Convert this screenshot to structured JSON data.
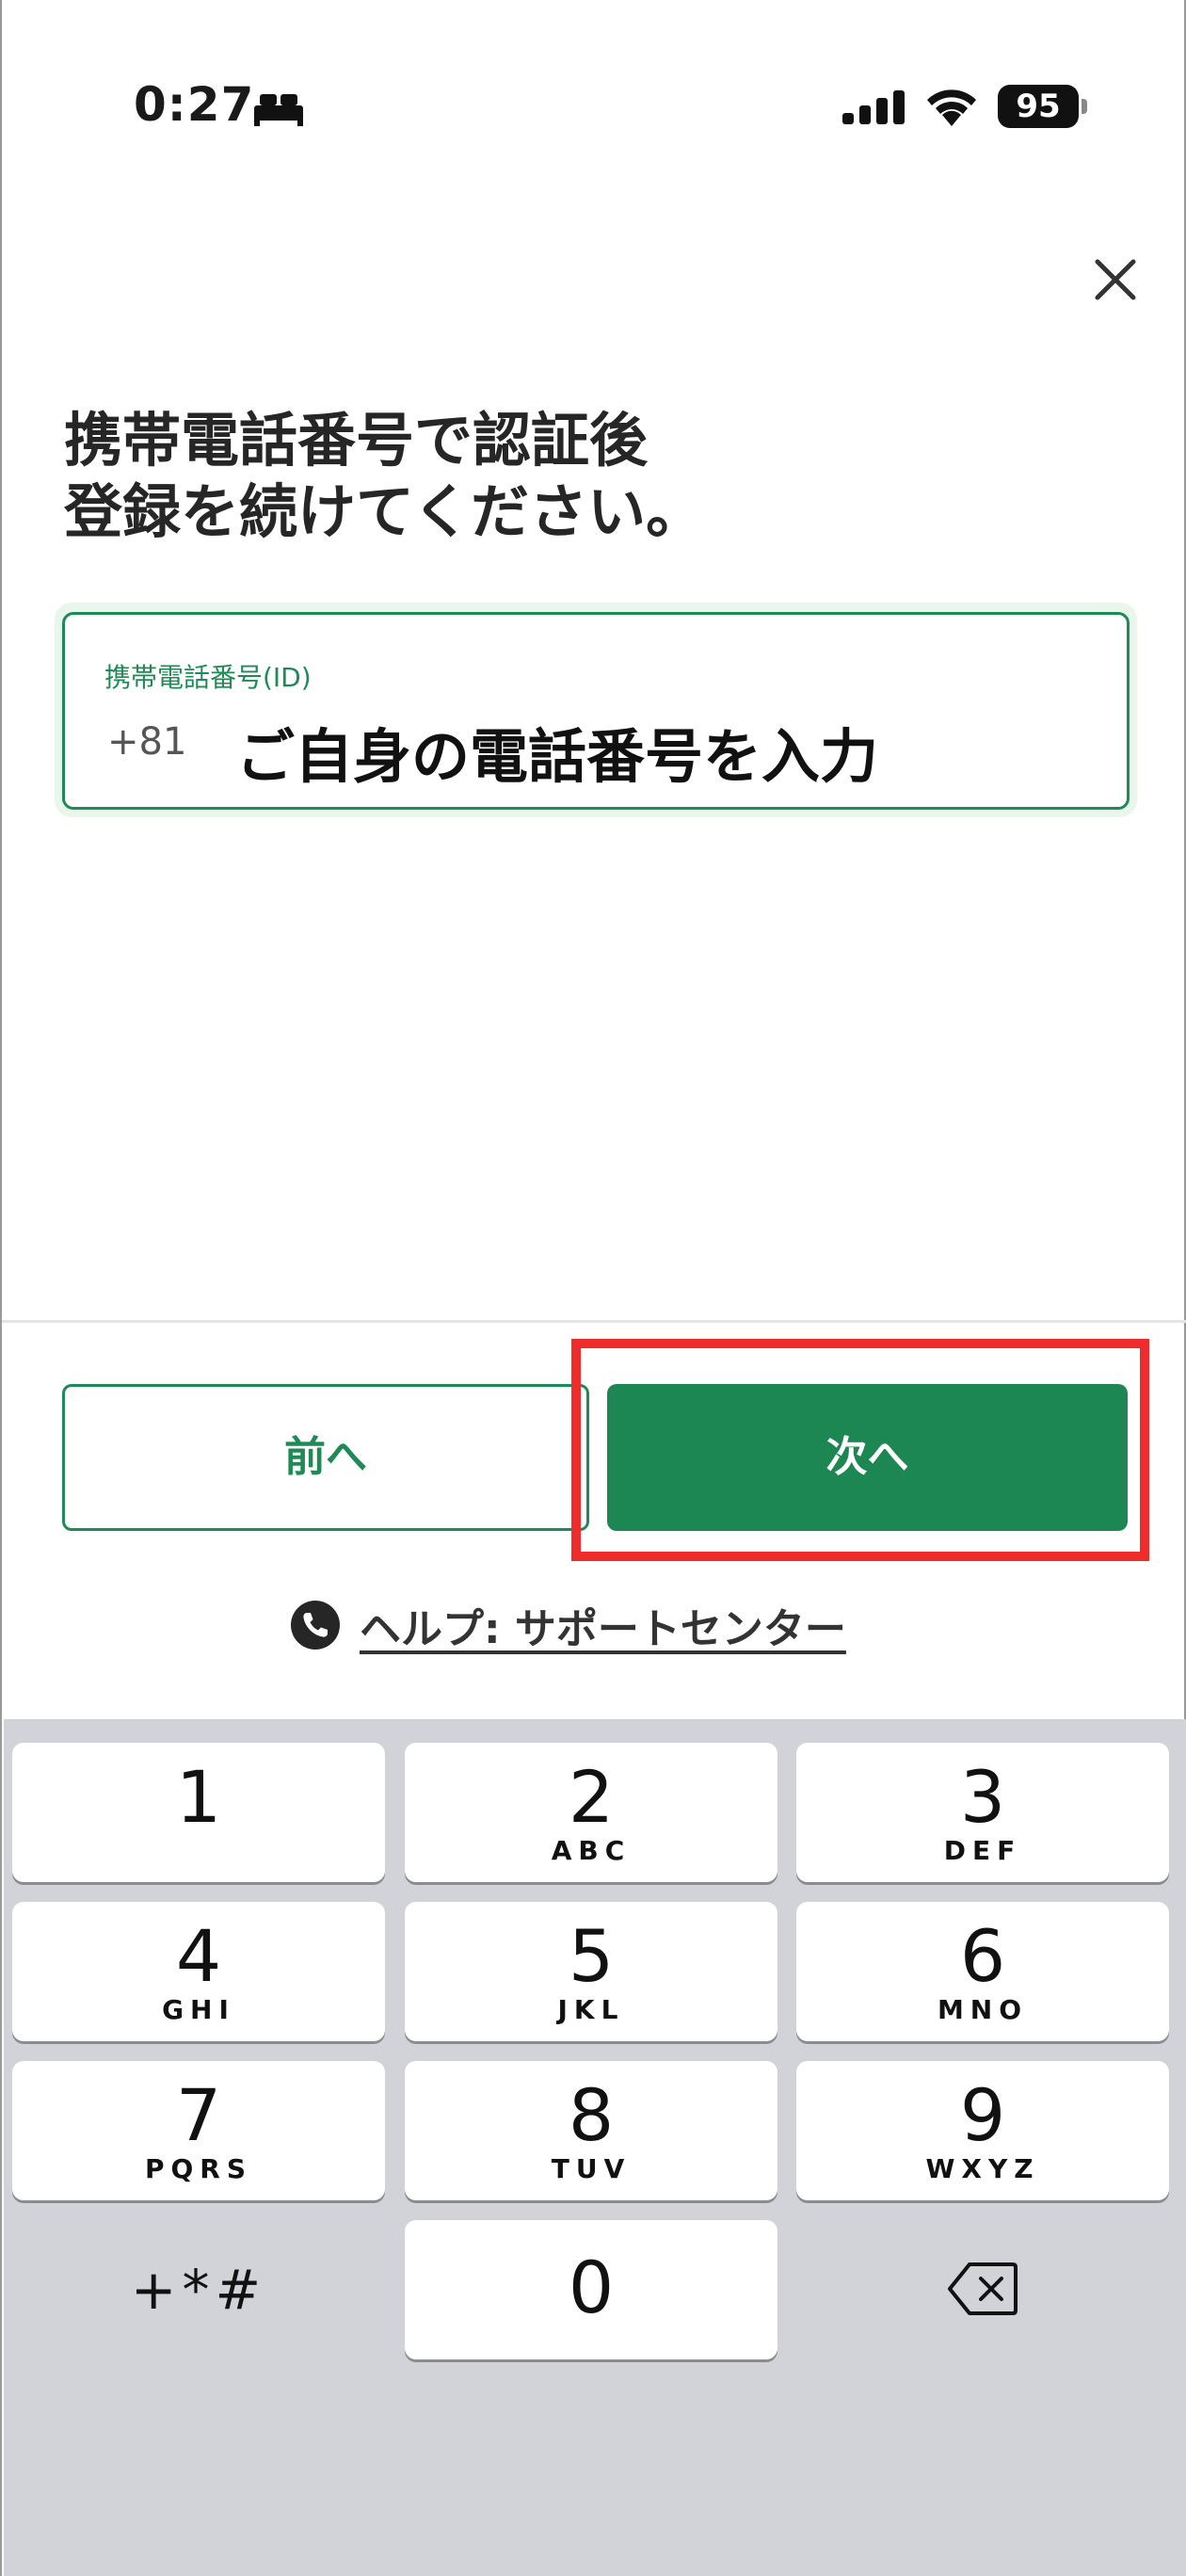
{
  "status_bar": {
    "time": "0:27",
    "battery": "95"
  },
  "heading": {
    "line1": "携帯電話番号で認証後",
    "line2": "登録を続けてください。"
  },
  "phone_field": {
    "label": "携帯電話番号(ID)",
    "country_code": "+81",
    "placeholder": "ご自身の電話番号を入力"
  },
  "buttons": {
    "prev": "前へ",
    "next": "次へ"
  },
  "help": {
    "text": "ヘルプ: サポートセンター"
  },
  "keypad": {
    "keys": [
      {
        "digit": "1",
        "letters": ""
      },
      {
        "digit": "2",
        "letters": "ABC"
      },
      {
        "digit": "3",
        "letters": "DEF"
      },
      {
        "digit": "4",
        "letters": "GHI"
      },
      {
        "digit": "5",
        "letters": "JKL"
      },
      {
        "digit": "6",
        "letters": "MNO"
      },
      {
        "digit": "7",
        "letters": "PQRS"
      },
      {
        "digit": "8",
        "letters": "TUV"
      },
      {
        "digit": "9",
        "letters": "WXYZ"
      },
      {
        "digit": "0",
        "letters": ""
      }
    ],
    "symbols": "+*#"
  },
  "colors": {
    "accent": "#1c8753",
    "highlight": "#ee2c2c",
    "keypad_bg": "#d1d3d9"
  }
}
